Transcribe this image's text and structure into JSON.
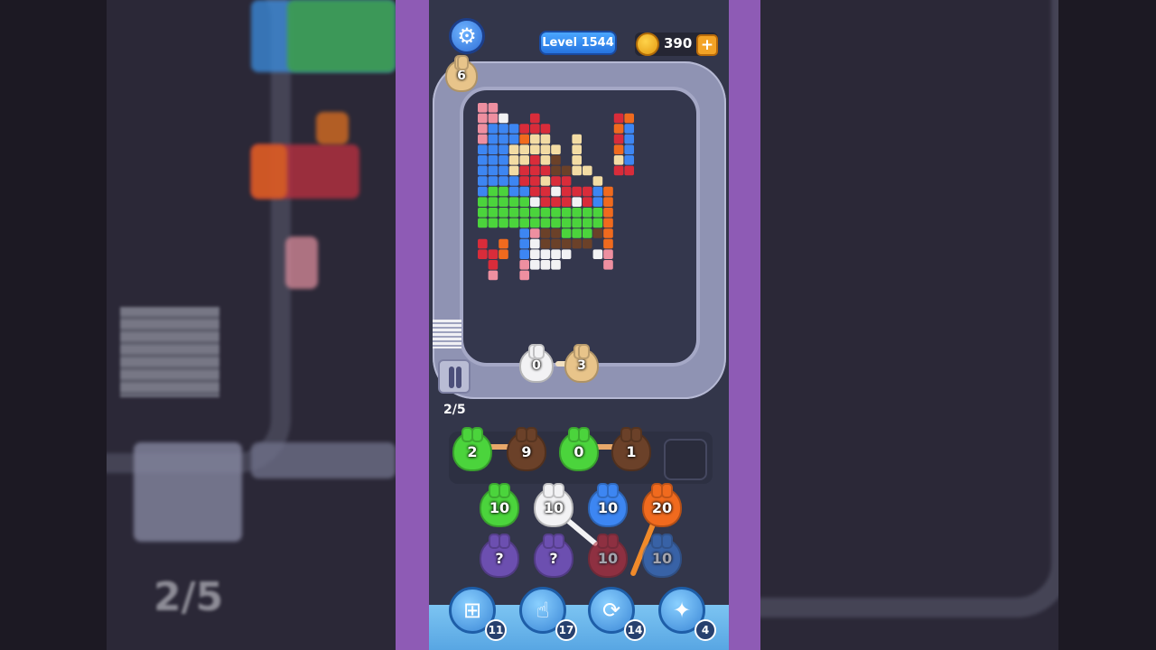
{
  "header": {
    "level_label": "Level 1544",
    "coins": "390",
    "coin_plus": "+",
    "settings_icon": "gear-icon"
  },
  "queue_creature_count": "6",
  "conveyor_creatures": [
    "0",
    "3"
  ],
  "slots_progress": "2/5",
  "side_progress_echo": "2/5",
  "holding_slots": [
    "2",
    "9",
    "0",
    "1"
  ],
  "grid": {
    "row1": [
      "10",
      "10",
      "10",
      "20"
    ],
    "row2": [
      "?",
      "?",
      "10",
      "10"
    ]
  },
  "tools": [
    {
      "name": "add-slot-icon",
      "count": "11"
    },
    {
      "name": "hand-pick-icon",
      "count": "17"
    },
    {
      "name": "shuffle-icon",
      "count": "14"
    },
    {
      "name": "magic-icon",
      "count": "4"
    }
  ],
  "colors": {
    "red": "#d92c3a",
    "orange": "#f06a1e",
    "blue": "#3d86f2",
    "cream": "#f3dca4",
    "white": "#f2f2f4",
    "green": "#4bd43c",
    "brown": "#6b4129",
    "pink": "#ee8fa0",
    "tan": "#e8c48a"
  },
  "pixel_art": {
    "legend": {
      "r": "red",
      "o": "orange",
      "b": "blue",
      "c": "cream",
      "w": "white",
      "g": "green",
      "n": "brown",
      "p": "pink"
    },
    "rows": [
      "pp..............",
      "ppw..r.......ro.",
      "pbbbrrr......ob.",
      "pbbbocc..c...rb.",
      "bbbccccc.c...ob.",
      "bbbccrcn.c...cb.",
      "bbbcrrrnncc..rr.",
      "bbbbrrcrr..c....",
      "bggbbrrwrrrbo...",
      "gggggwrrrwrbo...",
      "ggggggggggggo...",
      "ggggggggggggo...",
      "....bpnngggno...",
      "r.o.bwnnnnn.o...",
      "rro.bwwww..wp...",
      ".r..pwww....p...",
      ".p..p..........."
    ]
  }
}
